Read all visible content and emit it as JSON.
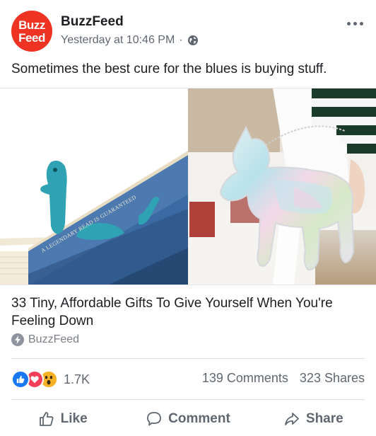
{
  "header": {
    "page_name": "BuzzFeed",
    "timestamp": "Yesterday at 10:46 PM",
    "separator": "·",
    "avatar_line1": "Buzz",
    "avatar_line2": "Feed",
    "avatar_color": "#ee3322"
  },
  "post": {
    "text": "Sometimes the best cure for the blues is buying stuff."
  },
  "media": {
    "left_image": {
      "subject": "sea-monster-bookmark",
      "book_cover_text": "A LEGENDARY READ IS GUARANTEED"
    },
    "right_image": {
      "subject": "holographic-unicorn-bag"
    }
  },
  "link": {
    "title": "33 Tiny, Affordable Gifts To Give Yourself When You're Feeling Down",
    "source": "BuzzFeed"
  },
  "engagement": {
    "reaction_icons": [
      "like-icon",
      "love-icon",
      "wow-icon"
    ],
    "reaction_count": "1.7K",
    "comments": "139 Comments",
    "shares": "323 Shares"
  },
  "actions": {
    "like": "Like",
    "comment": "Comment",
    "share": "Share"
  },
  "colors": {
    "like_blue": "#1877f2",
    "love_red": "#f33e58",
    "wow_yellow": "#f7b125",
    "muted_text": "#606770"
  }
}
